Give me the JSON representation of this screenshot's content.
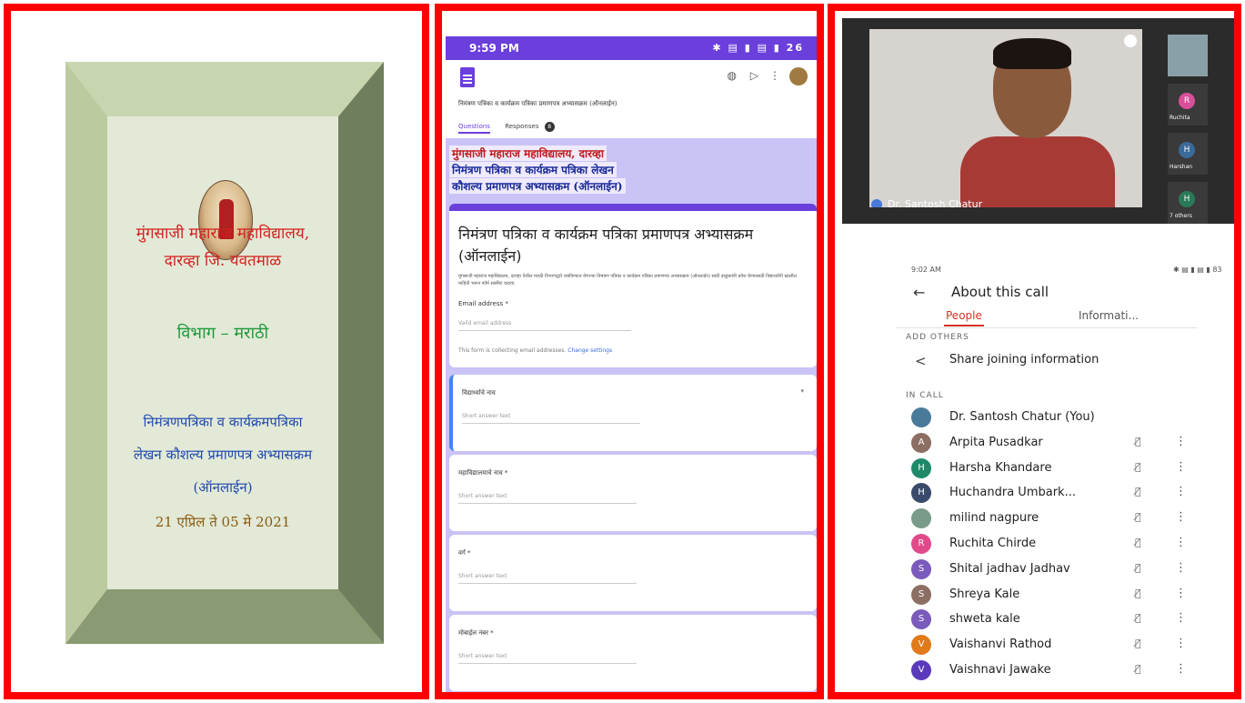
{
  "certificate": {
    "college_line1": "मुंगसाजी महाराज महाविद्यालय,",
    "college_line2": "दारव्हा जि. यवतमाळ",
    "department": "विभाग – मराठी",
    "course_line1": "निमंत्रणपत्रिका व कार्यक्रमपत्रिका",
    "course_line2": "लेखन कौशल्य प्रमाणपत्र अभ्यासक्रम",
    "course_line3": "(ऑनलाईन)",
    "dates": "21 एप्रिल ते 05 मे 2021",
    "colors": {
      "college": "#d42020",
      "department": "#1e9a3c",
      "course": "#2048b0",
      "date": "#8a5a10"
    }
  },
  "forms": {
    "status_time": "9:59 PM",
    "status_icons": "✱ ▤ ▮ ▤ ▮ 26",
    "toolbar_icons": [
      "palette-icon",
      "send-icon",
      "more-icon"
    ],
    "doc_title": "निमंत्रण पत्रिका व कार्यक्रम पत्रिका प्रमाणपत्र अभ्यासक्रम (ऑनलाईन)",
    "tab_questions": "Questions",
    "tab_responses": "Responses",
    "responses_count": "8",
    "header_line1": "मुंगसाजी महाराज महाविद्यालय, दारव्हा",
    "header_line2": "निमंत्रण पत्रिका व कार्यक्रम पत्रिका लेखन",
    "header_line3": "कौशल्य प्रमाणपत्र अभ्यासक्रम (ऑनलाईन)",
    "form_title": "निमंत्रण पत्रिका व कार्यक्रम पत्रिका प्रमाणपत्र अभ्यासक्रम (ऑनलाईन)",
    "description": "मुंगसाजी महाराज महाविद्यालय, दारव्हा येथील मराठी विभागाद्वारे राबविण्यात येणाऱ्या निमंत्रण पत्रिका व कार्यक्रम पत्रिका प्रमाणपत्र अभ्यासक्रम (ऑनलाईन) साठी इच्छुकांनी प्रवेश घेण्यासाठी विद्यार्थ्यांनी खालील माहिती भरून फॉर्म सबमिट करावा.",
    "email_label": "Email address *",
    "email_placeholder": "Valid email address",
    "email_note": "This form is collecting email addresses.",
    "change_settings": "Change settings",
    "questions": [
      {
        "label": "विद्यार्थ्याचे नाव",
        "placeholder": "Short answer text"
      },
      {
        "label": "महाविद्यालयाचे नाव *",
        "placeholder": "Short answer text"
      },
      {
        "label": "वर्ग *",
        "placeholder": "Short answer text"
      },
      {
        "label": "मोबाईल नंबर *",
        "placeholder": "Short answer text"
      }
    ],
    "accent": "#6a3fdc"
  },
  "meet": {
    "speaker": "Dr. Santosh Chatur",
    "thumbs": [
      {
        "initial": "",
        "name": ""
      },
      {
        "initial": "R",
        "name": "Ruchita",
        "color": "#d94f9a"
      },
      {
        "initial": "H",
        "name": "Harshan",
        "color": "#3a6a9a"
      },
      {
        "initial": "H",
        "name": "7 others",
        "color": "#2a7a5a"
      }
    ],
    "status_time": "9:02 AM",
    "status_right": "✱ ▤ ▮ ▤ ▮ 83",
    "title": "About this call",
    "tab_people": "People",
    "tab_info": "Informati...",
    "add_others": "ADD OTHERS",
    "share_text": "Share joining information",
    "in_call": "IN CALL",
    "participants": [
      {
        "initial": "",
        "name": "Dr. Santosh Chatur (You)",
        "color": "#4a7a9a",
        "host": true
      },
      {
        "initial": "A",
        "name": "Arpita Pusadkar",
        "color": "#8d6e63"
      },
      {
        "initial": "H",
        "name": "Harsha Khandare",
        "color": "#1e8a6a"
      },
      {
        "initial": "H",
        "name": "Huchandra Umbark...",
        "color": "#3a4a6a"
      },
      {
        "initial": "",
        "name": "milind nagpure",
        "color": "#7a9a8a"
      },
      {
        "initial": "R",
        "name": "Ruchita Chirde",
        "color": "#e04a8a"
      },
      {
        "initial": "S",
        "name": "Shital jadhav Jadhav",
        "color": "#7a5aba"
      },
      {
        "initial": "S",
        "name": "Shreya Kale",
        "color": "#8d6e63"
      },
      {
        "initial": "S",
        "name": "shweta kale",
        "color": "#7a5aba"
      },
      {
        "initial": "V",
        "name": "Vaishanvi Rathod",
        "color": "#e07a1a"
      },
      {
        "initial": "V",
        "name": "Vaishnavi Jawake",
        "color": "#5a3aba"
      }
    ],
    "mic_glyph": "🎙̸",
    "more_glyph": "⋮"
  }
}
